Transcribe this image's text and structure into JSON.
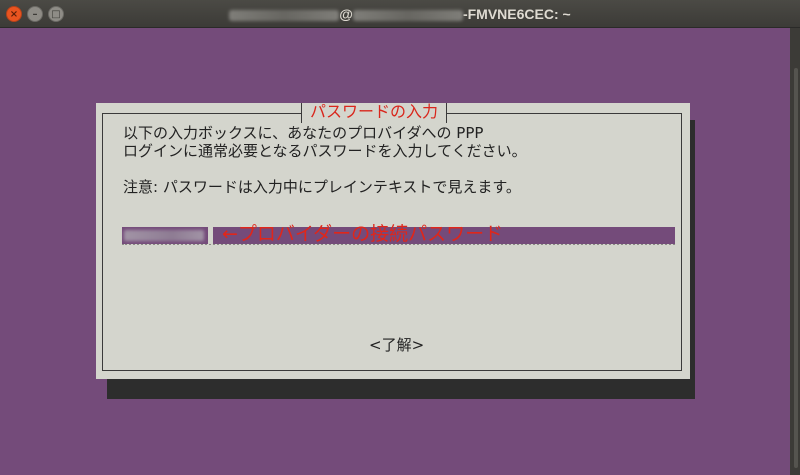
{
  "window": {
    "title_at": "@",
    "title_suffix": "-FMVNE6CEC: ~",
    "controls": {
      "close": "×",
      "minimize": "–",
      "maximize": "□"
    }
  },
  "dialog": {
    "title": "パスワードの入力",
    "message_line1": "以下の入力ボックスに、あなたのプロバイダへの PPP",
    "message_line2": "ログインに通常必要となるパスワードを入力してください。",
    "note": "注意: パスワードは入力中にプレインテキストで見えます。",
    "annotation": "←プロバイダーの接続パスワード",
    "ok_button": "<了解>"
  },
  "colors": {
    "terminal_bg": "#744b7a",
    "dialog_bg": "#d4d5cd",
    "annotation": "#e0261a",
    "close_button": "#e95420"
  }
}
